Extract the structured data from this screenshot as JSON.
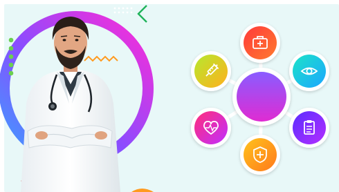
{
  "colors": {
    "background": "#e8f8f8",
    "ring_start": "#3aa0ff",
    "ring_end": "#ff2bd6",
    "center": "#c02be0",
    "accent_green": "#1fb35a",
    "accent_red": "#e04040",
    "accent_orange": "#ff9a1f"
  },
  "hub": {
    "center_icon": "circle",
    "nodes": [
      {
        "name": "first-aid-kit-node",
        "icon": "first-aid-kit-icon",
        "gradient": [
          "#ff3b3b",
          "#ff7a2d"
        ]
      },
      {
        "name": "eye-node",
        "icon": "eye-icon",
        "gradient": [
          "#1fe3c8",
          "#1aa6ff"
        ]
      },
      {
        "name": "clipboard-node",
        "icon": "clipboard-icon",
        "gradient": [
          "#5a2dff",
          "#b32dff"
        ]
      },
      {
        "name": "shield-cross-node",
        "icon": "shield-cross-icon",
        "gradient": [
          "#ffb01f",
          "#ff7a1f"
        ]
      },
      {
        "name": "heart-pulse-node",
        "icon": "heart-pulse-icon",
        "gradient": [
          "#ff2f7a",
          "#c12dff"
        ]
      },
      {
        "name": "syringe-node",
        "icon": "syringe-icon",
        "gradient": [
          "#b6e82d",
          "#ffb01f"
        ]
      }
    ]
  },
  "doctor": {
    "icon": "doctor-illustration"
  }
}
